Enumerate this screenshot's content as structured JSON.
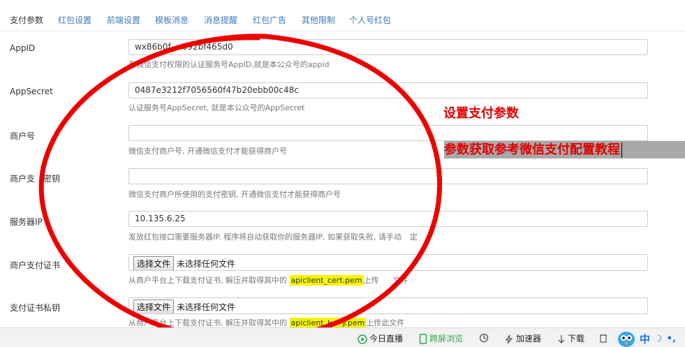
{
  "tabs": [
    {
      "label": "支付参数"
    },
    {
      "label": "红包设置"
    },
    {
      "label": "前端设置"
    },
    {
      "label": "模板消息"
    },
    {
      "label": "消息提醒"
    },
    {
      "label": "红包广告"
    },
    {
      "label": "其他限制"
    },
    {
      "label": "个人号红包"
    }
  ],
  "form": {
    "appid": {
      "label": "AppID",
      "value_a": "wx86b0f",
      "value_b": "092bf465d0",
      "hint": "有微信支付权限的认证服务号AppID,就是本公众号的appid"
    },
    "appsecret": {
      "label": "AppSecret",
      "value": "0487e3212f7056560f47b20ebb00c48c",
      "hint": "认证服务号AppSecret, 就是本公众号的AppSecret"
    },
    "merchant_no": {
      "label": "商户号",
      "value": "",
      "hint": "微信支付商户号, 开通微信支付才能获得商户号"
    },
    "pay_key": {
      "label_a": "商户支",
      "label_b": "密钥",
      "value": "",
      "hint": "微信支付商户所使用的支付密钥, 开通微信支付才能获得商户号"
    },
    "server_ip": {
      "label": "服务器IP",
      "value": "10.135.6.25",
      "hint_a": "发放红包接口需要服务器IP. 程序将自动获取你的服务器IP, 如果获取失败, 请手动",
      "hint_b": "定"
    },
    "cert": {
      "label": "商户支付证书",
      "button": "选择文件",
      "no_file": "未选择任何文件",
      "hint_pre": "从商户平台上下载支付证书, 解压并取得其中的",
      "hint_file": "apiclient_cert.pem",
      "hint_post_a": "上传",
      "hint_post_b": "文件"
    },
    "key": {
      "label": "支付证书私钥",
      "button": "选择文件",
      "no_file": "未选择任何文件",
      "hint_pre": "从商户平台上下载支付证书, 解压并取得其中的",
      "hint_file_a": "apiclient_k",
      "hint_file_b": "y.pem",
      "hint_post": "上传此文件"
    }
  },
  "annotations": {
    "title": "设置支付参数",
    "subtitle": "参数获取参考微信支付配置教程"
  },
  "statusbar": {
    "live": "今日直播",
    "cross_screen": "跨屏浏览",
    "accelerator": "加速器",
    "download": "下载",
    "ime_zh": "中"
  },
  "colors": {
    "tab_link": "#3c7ab8",
    "annotation_red": "#e00000",
    "highlight": "#f6f500",
    "ellipse": "#ee0000"
  }
}
